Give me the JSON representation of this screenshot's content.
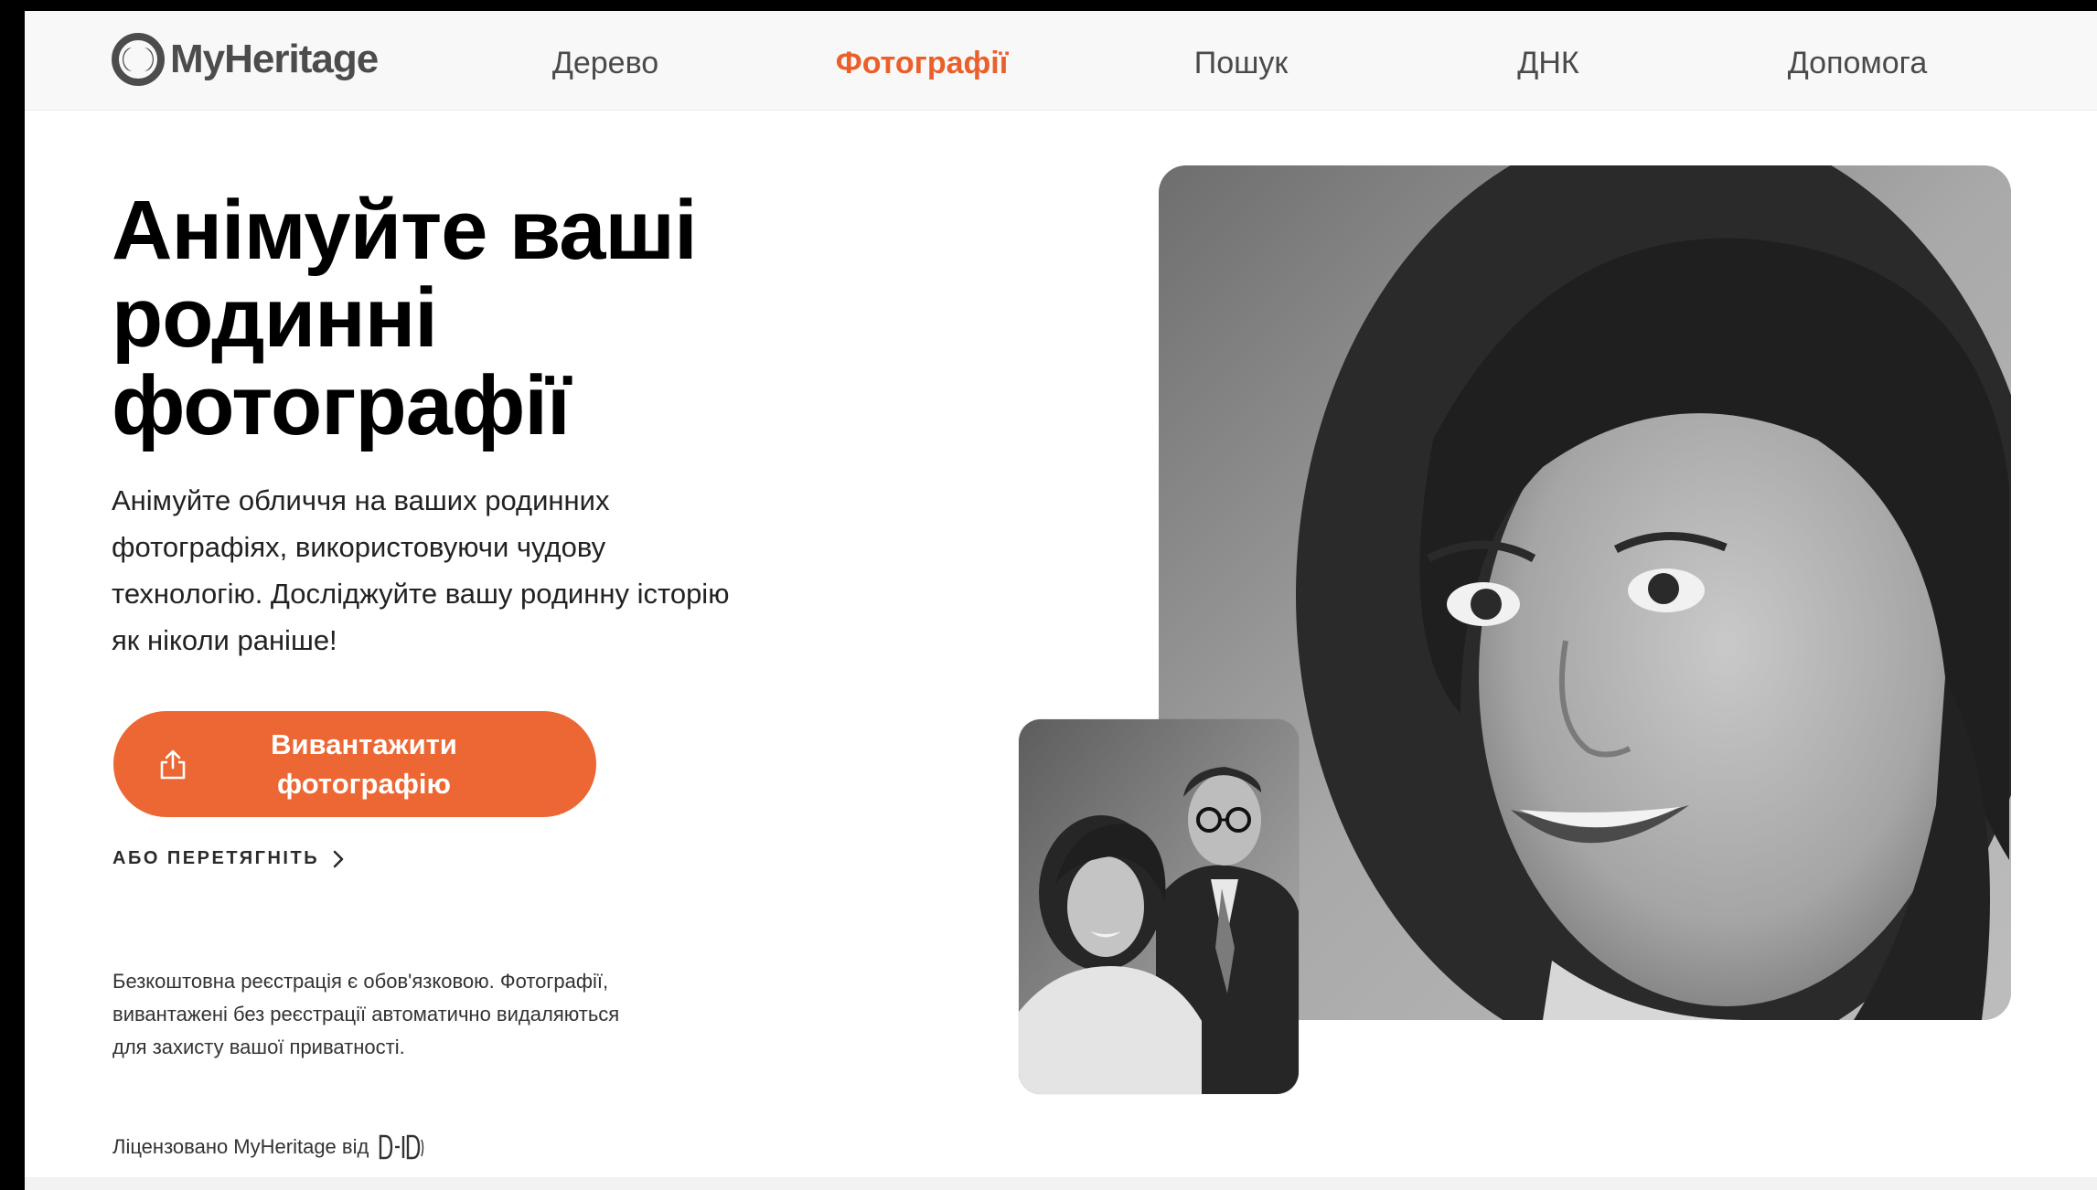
{
  "brand": {
    "name": "MyHeritage",
    "accent": "#ec6733"
  },
  "nav": {
    "items": [
      {
        "label": "Дерево",
        "active": false
      },
      {
        "label": "Фотографії",
        "active": true
      },
      {
        "label": "Пошук",
        "active": false
      },
      {
        "label": "ДНК",
        "active": false
      },
      {
        "label": "Допомога",
        "active": false
      }
    ]
  },
  "hero": {
    "title": "Анімуйте ваші родинні фотографії",
    "description": "Анімуйте обличчя на ваших родинних фотографіях, використовуючи чудову технологію. Досліджуйте вашу родинну історію як ніколи раніше!",
    "upload_button": "Вивантажити фотографію",
    "drag_link": "АБО ПЕРЕТЯГНІТЬ",
    "privacy_note": "Безкоштовна реєстрація є обов'язковою. Фотографії, вивантажені без реєстрації автоматично видаляються для захисту вашої приватності.",
    "license_text": "Ліцензовано MyHeritage від",
    "license_partner": "D-ID"
  },
  "icons": {
    "logo": "myheritage-logo-icon",
    "upload": "upload-icon",
    "chevron": "chevron-right-icon"
  }
}
